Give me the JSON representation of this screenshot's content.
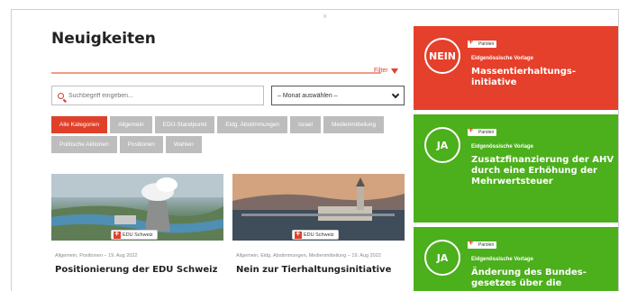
{
  "news": {
    "title": "Neuigkeiten",
    "filter_label": "Filter",
    "search_placeholder": "Suchbegriff eingeben...",
    "month_select": "– Monat auswählen –",
    "categories": [
      {
        "label": "Alle Kategorien",
        "active": true
      },
      {
        "label": "Allgemein",
        "active": false
      },
      {
        "label": "EDU-Standpunkt",
        "active": false
      },
      {
        "label": "Eidg. Abstimmungen",
        "active": false
      },
      {
        "label": "Israel",
        "active": false
      },
      {
        "label": "Medienmitteilung",
        "active": false
      },
      {
        "label": "Politische Aktionen",
        "active": false
      },
      {
        "label": "Positionen",
        "active": false
      },
      {
        "label": "Wahlen",
        "active": false
      }
    ],
    "cards": [
      {
        "badge": "EDU Schweiz",
        "meta": "Allgemein, Positionen – 19. Aug 2022",
        "headline": "Positionierung der EDU Schweiz"
      },
      {
        "badge": "EDU Schweiz",
        "meta": "Allgemein, Eidg. Abstimmungen, Medienmitteilung – 19. Aug 2022",
        "headline": "Nein zur Tierhaltungsinitiative"
      }
    ]
  },
  "votes": [
    {
      "recommendation": "NEIN",
      "tag": "Parolen",
      "kicker": "Eidgenössische Vorlage",
      "title": "Massentierhaltungs-initiative",
      "color": "#e5402b"
    },
    {
      "recommendation": "JA",
      "tag": "Parolen",
      "kicker": "Eidgenössische Vorlage",
      "title": "Zusatzfinanzierung der AHV durch eine Erhöhung der Mehrwertsteuer",
      "color": "#4caf1c"
    },
    {
      "recommendation": "JA",
      "tag": "Parolen",
      "kicker": "Eidgenössische Vorlage",
      "title": "Änderung des Bundes-gesetzes über die",
      "color": "#4caf1c"
    }
  ]
}
